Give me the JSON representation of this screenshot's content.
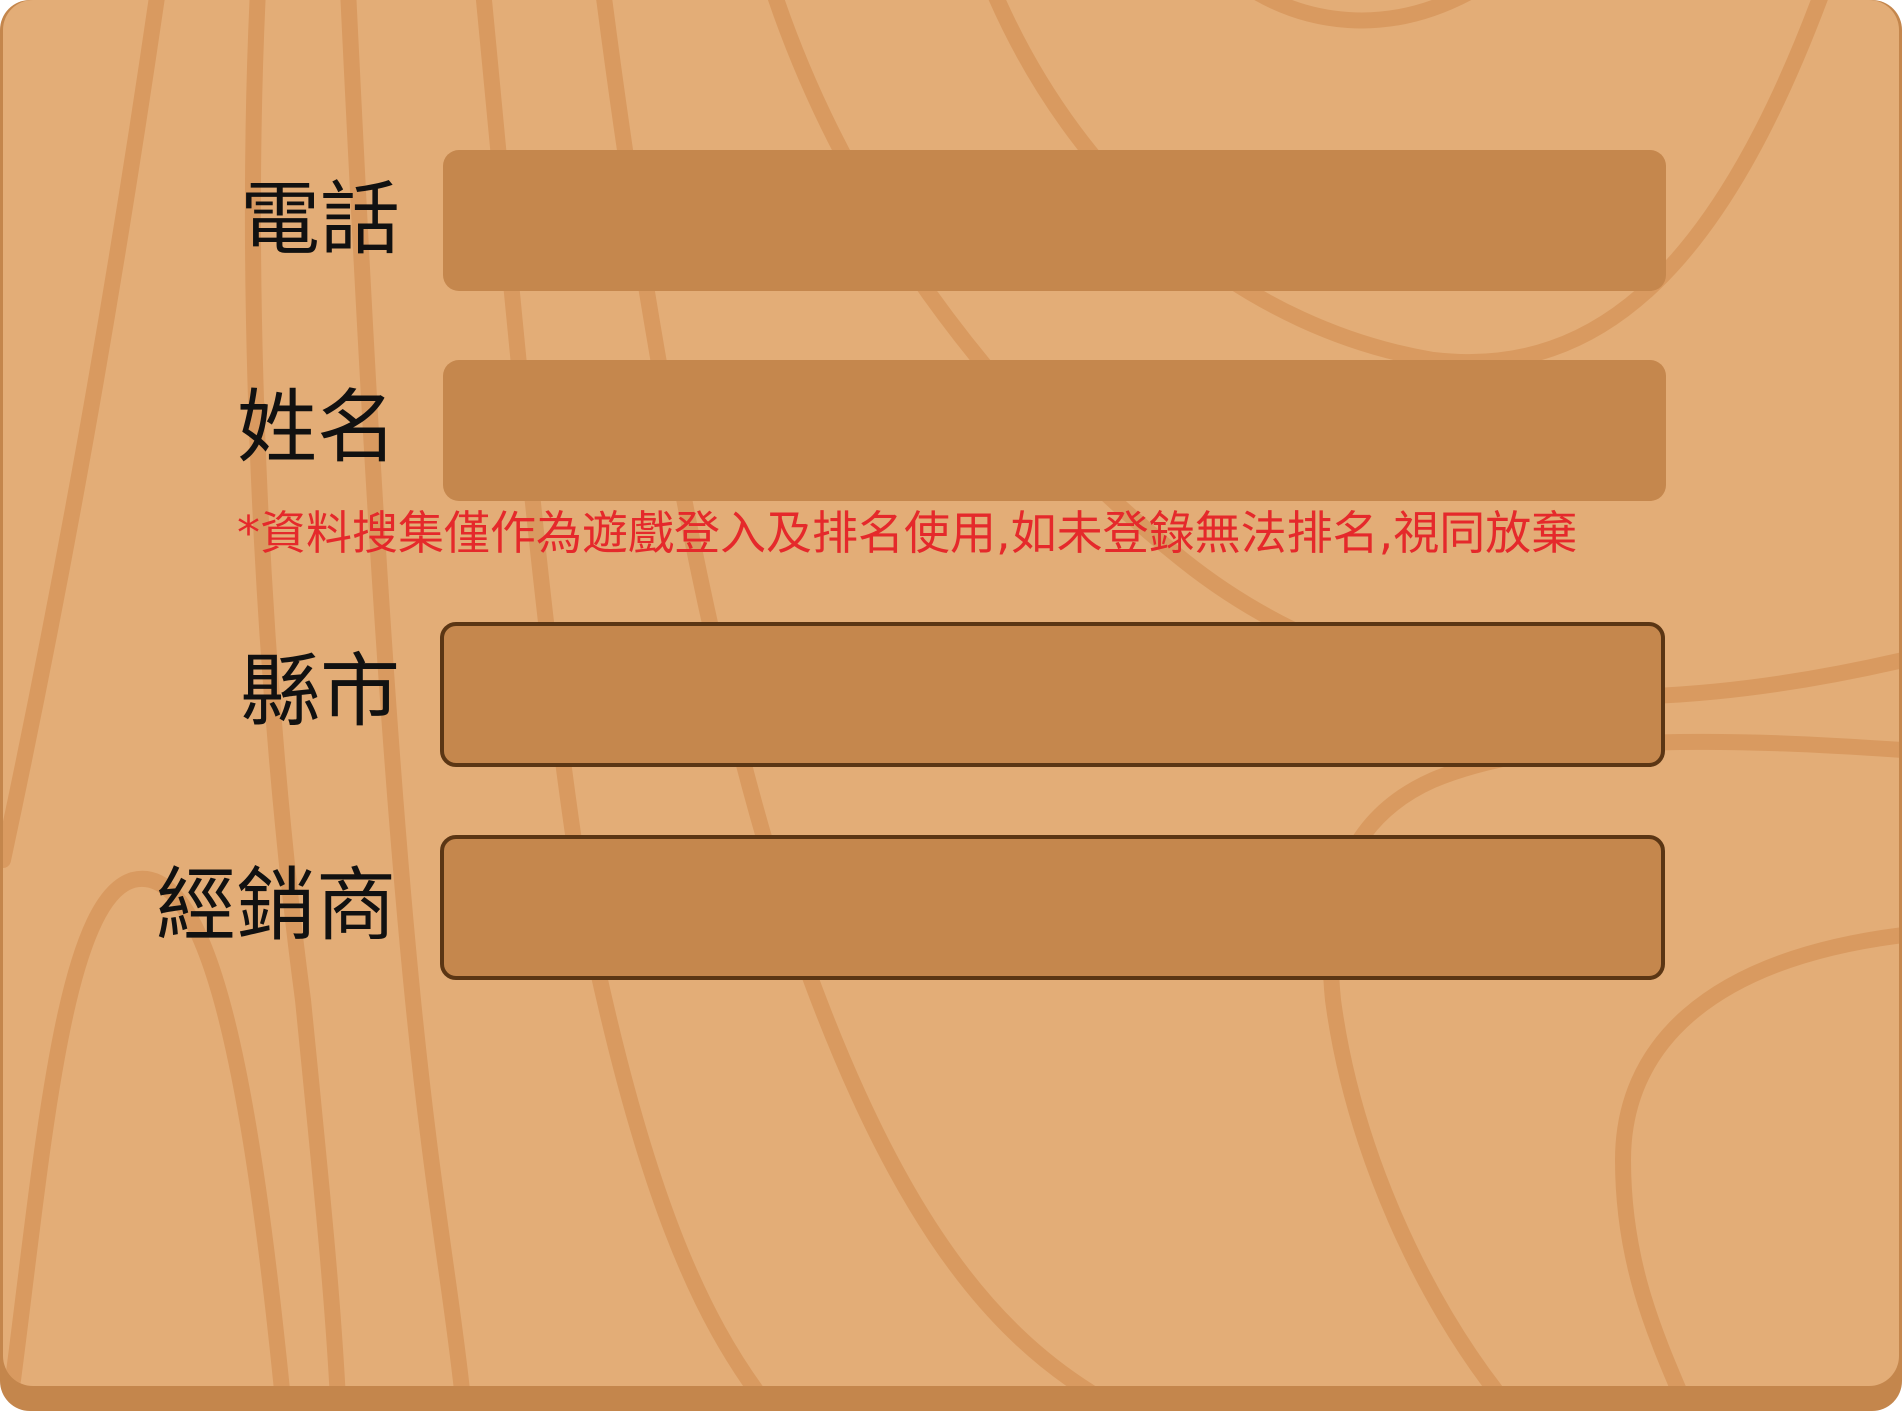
{
  "form": {
    "fields": [
      {
        "id": "phone",
        "label": "電話",
        "value": "",
        "placeholder": ""
      },
      {
        "id": "name",
        "label": "姓名",
        "value": "",
        "placeholder": ""
      },
      {
        "id": "city",
        "label": "縣市",
        "value": "",
        "placeholder": ""
      },
      {
        "id": "dealer",
        "label": "經銷商",
        "value": "",
        "placeholder": ""
      }
    ],
    "notice": "*資料搜集僅作為遊戲登入及排名使用,如未登錄無法排名,視同放棄"
  },
  "colors": {
    "board": "#e3ad77",
    "board_edge": "#c4864c",
    "grain": "#d99a60",
    "field": "#c5874d",
    "field_border": "#5b3614",
    "notice": "#e5292b",
    "label": "#111111"
  }
}
